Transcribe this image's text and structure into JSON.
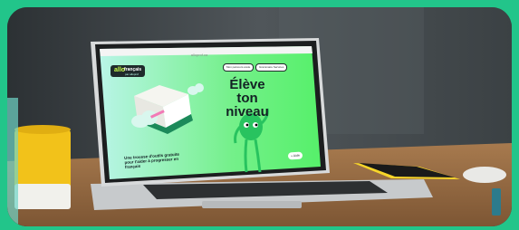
{
  "browser": {
    "title": "alloprof.ca"
  },
  "site": {
    "logo_primary": "allo",
    "logo_secondary": "français",
    "logo_tagline": "par alloprof",
    "nav_buttons": [
      "Mon parcours école",
      "Grammaire Services"
    ],
    "headline_lines": [
      "Élève",
      "ton",
      "niveau"
    ],
    "tagline": "Une trousse d'outils gratuite pour t'aider à progresser en français",
    "help_chip": "+ Aide"
  },
  "colors": {
    "border_green": "#22c58a",
    "page_bg": "#3b3f44",
    "site_gradient_left": "#b9f5e7",
    "site_gradient_right": "#56f06a",
    "mascot_green": "#28c35f",
    "mug_yellow": "#f2c21a",
    "phone_yellow": "#f7d52a"
  }
}
